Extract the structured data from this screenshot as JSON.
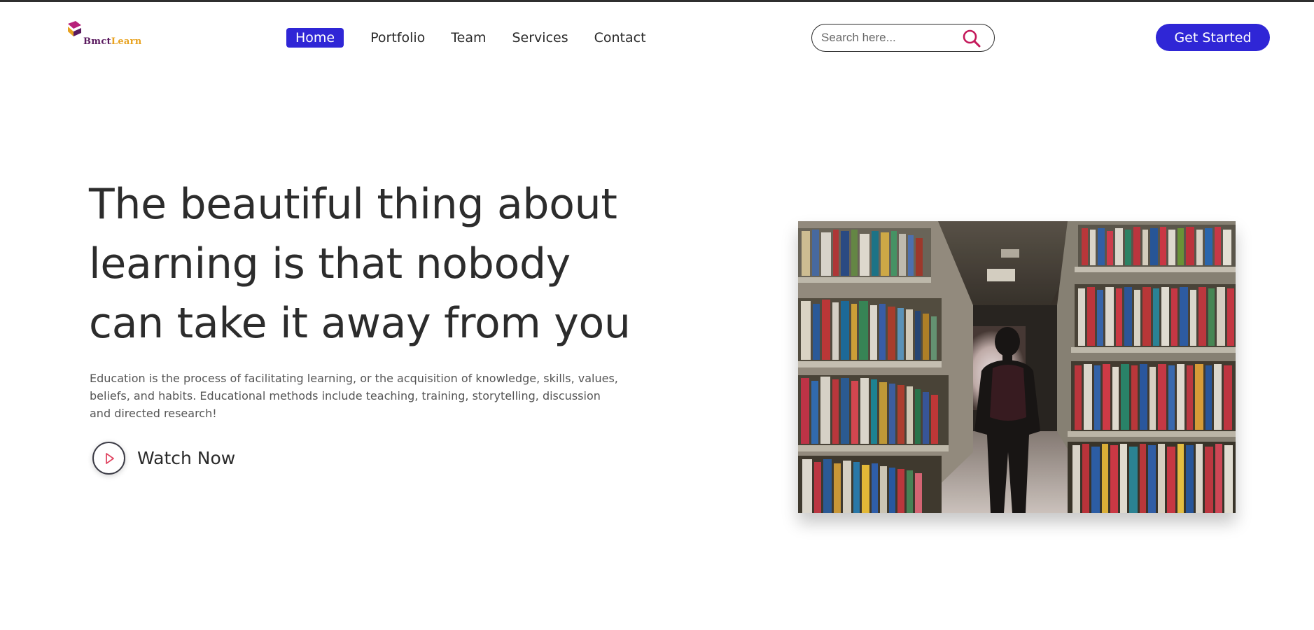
{
  "brand": {
    "name_part1": "Bmct",
    "name_part2": "Learn",
    "colors": {
      "primary": "#2f26d6",
      "logo_purple": "#5a1a5f",
      "logo_gold": "#e8a21f",
      "logo_magenta": "#b8227a"
    }
  },
  "nav": {
    "items": [
      {
        "label": "Home",
        "active": true
      },
      {
        "label": "Portfolio",
        "active": false
      },
      {
        "label": "Team",
        "active": false
      },
      {
        "label": "Services",
        "active": false
      },
      {
        "label": "Contact",
        "active": false
      }
    ]
  },
  "search": {
    "placeholder": "Search here...",
    "value": "",
    "icon": "search-icon",
    "icon_color": "#c4185a"
  },
  "header": {
    "cta_label": "Get Started"
  },
  "hero": {
    "title": "The beautiful thing about learning is that nobody can take it away from you",
    "description": "Education is the process of facilitating learning, or the acquisition of knowledge, skills, values, beliefs, and habits. Educational methods include teaching, training, storytelling, discussion and directed research!",
    "watch_label": "Watch Now",
    "watch_icon": "play-icon",
    "image_subject": "library-aisle-photo"
  }
}
